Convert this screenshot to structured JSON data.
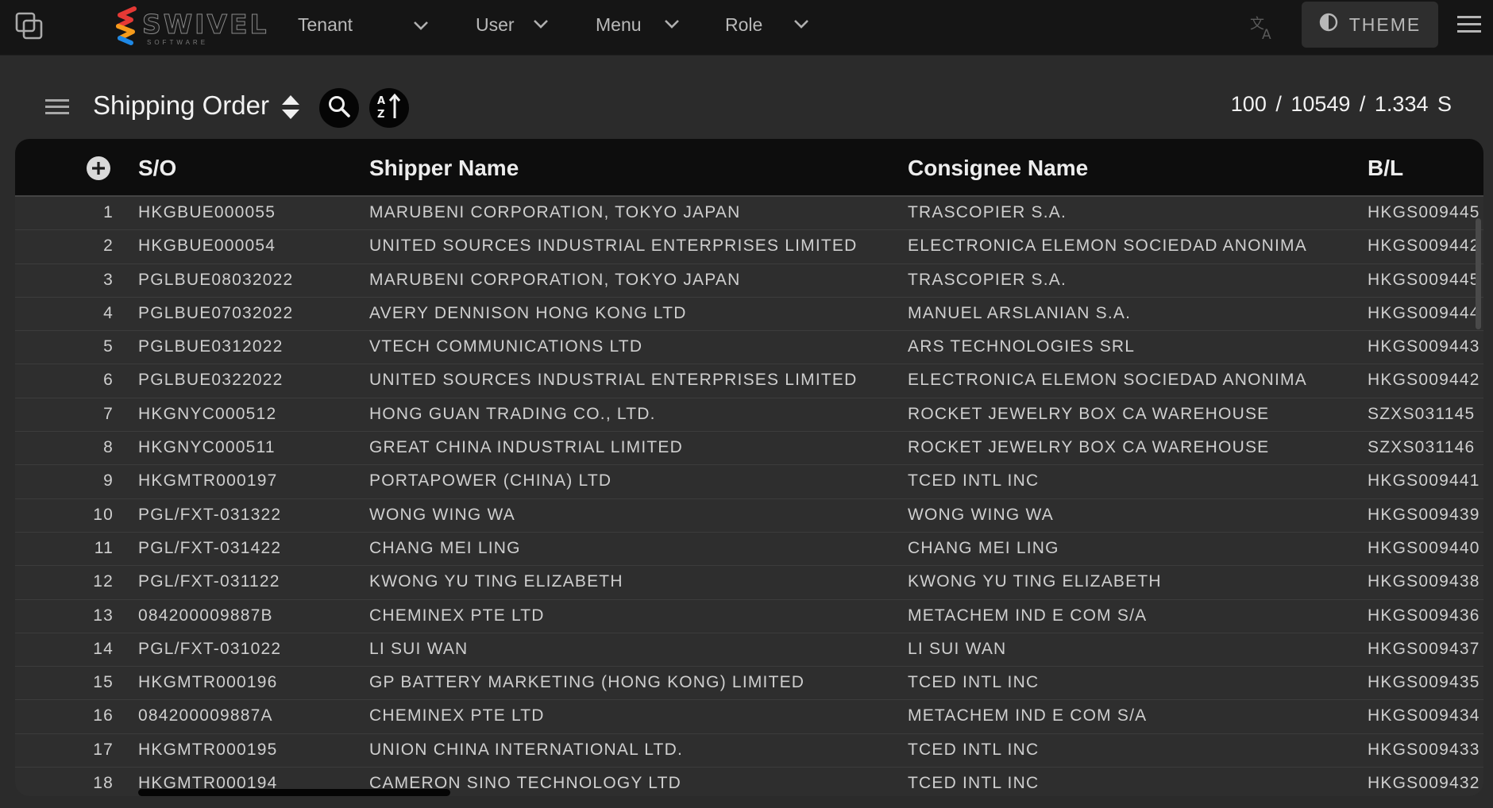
{
  "topbar": {
    "logo_text": "SWIVEL",
    "logo_sub": "SOFTWARE",
    "tenant_label": "Tenant",
    "user_label": "User",
    "menu_label": "Menu",
    "role_label": "Role",
    "theme_label": "THEME"
  },
  "header": {
    "title": "Shipping Order",
    "counts": "100  /  10549  /  1.334 S"
  },
  "table": {
    "columns": [
      "S/O",
      "Shipper Name",
      "Consignee Name",
      "B/L"
    ],
    "rows": [
      {
        "no": "1",
        "so": "HKGBUE000055",
        "shipper": "MARUBENI CORPORATION, TOKYO JAPAN",
        "consignee": "TRASCOPIER S.A.",
        "bl": "HKGS009445"
      },
      {
        "no": "2",
        "so": "HKGBUE000054",
        "shipper": "UNITED SOURCES INDUSTRIAL ENTERPRISES LIMITED",
        "consignee": "ELECTRONICA ELEMON SOCIEDAD ANONIMA",
        "bl": "HKGS009442"
      },
      {
        "no": "3",
        "so": "PGLBUE08032022",
        "shipper": "MARUBENI CORPORATION, TOKYO JAPAN",
        "consignee": "TRASCOPIER S.A.",
        "bl": "HKGS009445"
      },
      {
        "no": "4",
        "so": "PGLBUE07032022",
        "shipper": "AVERY DENNISON HONG KONG LTD",
        "consignee": "MANUEL ARSLANIAN S.A.",
        "bl": "HKGS009444"
      },
      {
        "no": "5",
        "so": "PGLBUE0312022",
        "shipper": "VTECH COMMUNICATIONS LTD",
        "consignee": "ARS TECHNOLOGIES SRL",
        "bl": "HKGS009443"
      },
      {
        "no": "6",
        "so": "PGLBUE0322022",
        "shipper": "UNITED SOURCES INDUSTRIAL ENTERPRISES LIMITED",
        "consignee": "ELECTRONICA ELEMON SOCIEDAD ANONIMA",
        "bl": "HKGS009442"
      },
      {
        "no": "7",
        "so": "HKGNYC000512",
        "shipper": "HONG GUAN TRADING CO., LTD.",
        "consignee": "ROCKET JEWELRY BOX CA WAREHOUSE",
        "bl": "SZXS031145"
      },
      {
        "no": "8",
        "so": "HKGNYC000511",
        "shipper": "GREAT CHINA INDUSTRIAL LIMITED",
        "consignee": "ROCKET JEWELRY BOX CA WAREHOUSE",
        "bl": "SZXS031146"
      },
      {
        "no": "9",
        "so": "HKGMTR000197",
        "shipper": "PORTAPOWER (CHINA) LTD",
        "consignee": "TCED INTL INC",
        "bl": "HKGS009441"
      },
      {
        "no": "10",
        "so": "PGL/FXT-031322",
        "shipper": "WONG WING WA",
        "consignee": "WONG WING WA",
        "bl": "HKGS009439"
      },
      {
        "no": "11",
        "so": "PGL/FXT-031422",
        "shipper": "CHANG MEI LING",
        "consignee": "CHANG MEI LING",
        "bl": "HKGS009440"
      },
      {
        "no": "12",
        "so": "PGL/FXT-031122",
        "shipper": "KWONG YU TING ELIZABETH",
        "consignee": "KWONG YU TING ELIZABETH",
        "bl": "HKGS009438"
      },
      {
        "no": "13",
        "so": "084200009887B",
        "shipper": "CHEMINEX PTE LTD",
        "consignee": "METACHEM IND E COM S/A",
        "bl": "HKGS009436"
      },
      {
        "no": "14",
        "so": "PGL/FXT-031022",
        "shipper": "LI SUI WAN",
        "consignee": "LI SUI WAN",
        "bl": "HKGS009437"
      },
      {
        "no": "15",
        "so": "HKGMTR000196",
        "shipper": "GP BATTERY MARKETING (HONG KONG) LIMITED",
        "consignee": "TCED INTL INC",
        "bl": "HKGS009435"
      },
      {
        "no": "16",
        "so": "084200009887A",
        "shipper": "CHEMINEX PTE LTD",
        "consignee": "METACHEM IND E COM S/A",
        "bl": "HKGS009434"
      },
      {
        "no": "17",
        "so": "HKGMTR000195",
        "shipper": "UNION CHINA INTERNATIONAL LTD.",
        "consignee": "TCED INTL INC",
        "bl": "HKGS009433"
      },
      {
        "no": "18",
        "so": "HKGMTR000194",
        "shipper": "CAMERON SINO TECHNOLOGY LTD",
        "consignee": "TCED INTL INC",
        "bl": "HKGS009432"
      }
    ]
  },
  "icons": {
    "window": "window-copy-icon",
    "translate": "translate-icon",
    "theme": "contrast-icon",
    "menu": "hamburger-icon",
    "search": "search-icon",
    "sort": "sort-az-icon",
    "add": "add-circle-icon",
    "chevron": "chevron-down-icon"
  },
  "colors": {
    "logo_red": "#e53935",
    "logo_orange": "#f59b1b",
    "logo_blue": "#1e88e5",
    "topbar_bg": "#151515",
    "page_bg": "#2b2b2b"
  }
}
